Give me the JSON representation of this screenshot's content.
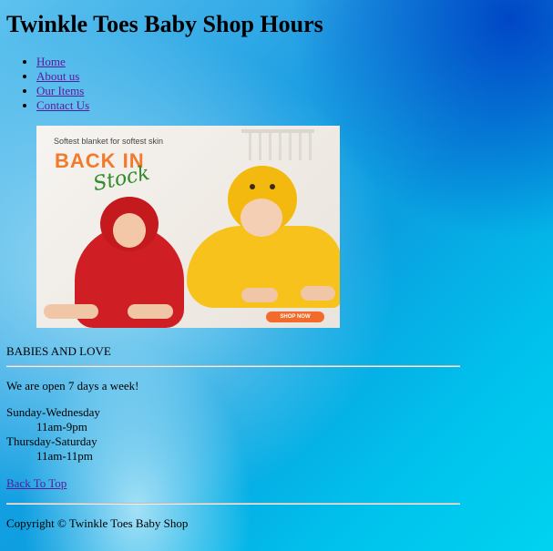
{
  "header": {
    "title": "Twinkle Toes Baby Shop Hours"
  },
  "nav": {
    "items": [
      {
        "label": "Home"
      },
      {
        "label": "About us"
      },
      {
        "label": "Our Items"
      },
      {
        "label": "Contact Us"
      }
    ]
  },
  "banner": {
    "tagline": "Softest blanket for softest skin",
    "headline": "BACK IN",
    "script_text": "Stock",
    "button_label": "SHOP NOW"
  },
  "main": {
    "section_title": "BABIES AND LOVE",
    "open_note": "We are open 7 days a week!",
    "hours": [
      {
        "days": "Sunday-Wednesday",
        "time": "11am-9pm"
      },
      {
        "days": "Thursday-Saturday",
        "time": "11am-11pm"
      }
    ],
    "back_to_top": "Back To Top"
  },
  "footer": {
    "copyright": "Copyright © Twinkle Toes Baby Shop"
  },
  "colors": {
    "link": "#5a1a9a",
    "background_accent": "#0a9fe0",
    "banner_orange": "#f27a2a"
  }
}
